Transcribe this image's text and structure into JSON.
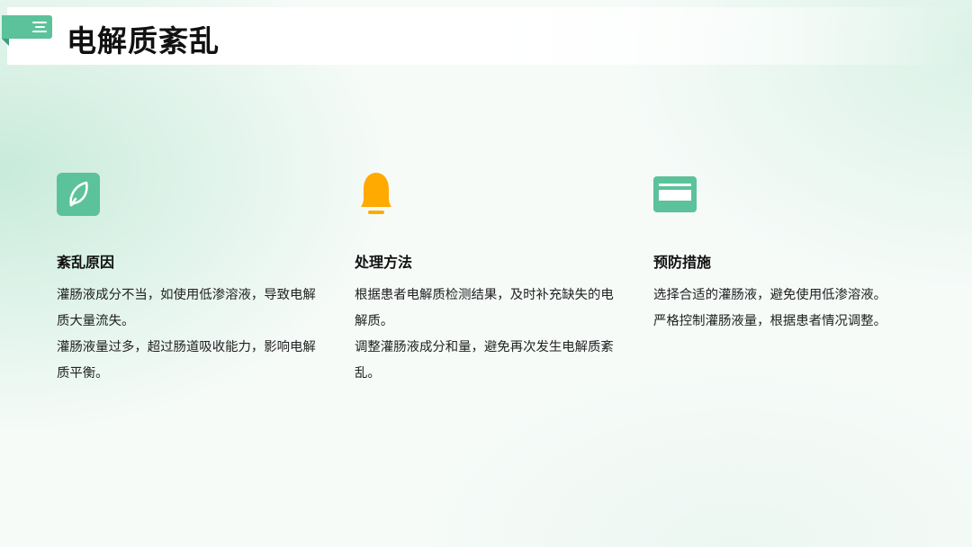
{
  "header": {
    "title": "电解质紊乱"
  },
  "colors": {
    "accent_green": "#5bc29c",
    "accent_orange": "#ffaa00",
    "text": "#111111"
  },
  "columns": [
    {
      "icon": "leaf-icon",
      "heading": "紊乱原因",
      "paragraphs": [
        "灌肠液成分不当，如使用低渗溶液，导致电解质大量流失。",
        "灌肠液量过多，超过肠道吸收能力，影响电解质平衡。"
      ]
    },
    {
      "icon": "bell-icon",
      "heading": "处理方法",
      "paragraphs": [
        "根据患者电解质检测结果，及时补充缺失的电解质。",
        "调整灌肠液成分和量，避免再次发生电解质紊乱。"
      ]
    },
    {
      "icon": "card-icon",
      "heading": "预防措施",
      "paragraphs": [
        "选择合适的灌肠液，避免使用低渗溶液。",
        "严格控制灌肠液量，根据患者情况调整。"
      ]
    }
  ]
}
